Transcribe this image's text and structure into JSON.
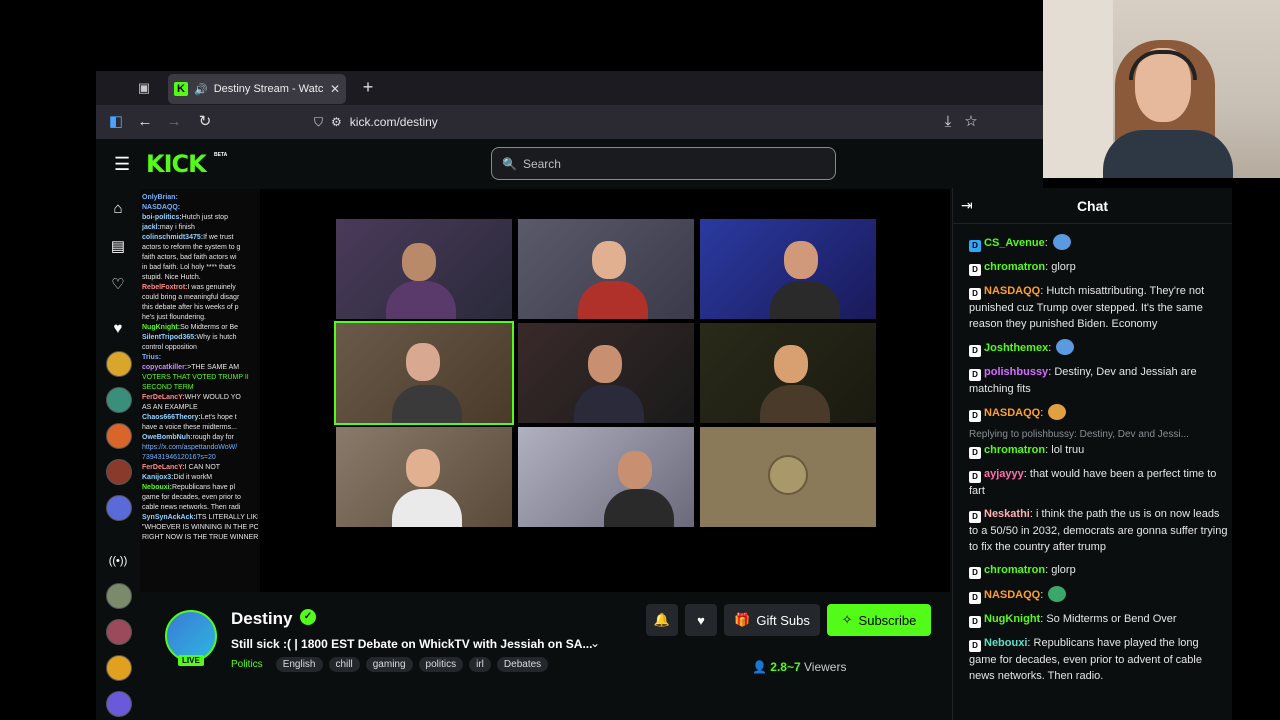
{
  "browser": {
    "tab": {
      "title": "Destiny Stream - Watch Live",
      "favicon": "K"
    },
    "url": "kick.com/destiny"
  },
  "kick": {
    "logo": "KICK",
    "beta": "BETA",
    "search_placeholder": "Search"
  },
  "overlay_chat": [
    {
      "user": "OnlyBrian:",
      "text": "",
      "color": "#6fb3ff"
    },
    {
      "user": "NASDAQQ:",
      "text": "",
      "color": "#6fb3ff"
    },
    {
      "user": "boi-politics:",
      "text": "Hutch just stop",
      "color": "#e6e6e6"
    },
    {
      "user": "jackl:",
      "text": "may i finish",
      "color": "#e6e6e6"
    },
    {
      "user": "colinschmidt3475:",
      "text": "If we trust",
      "color": "#e6e6e6"
    },
    {
      "user": "",
      "text": "actors to reform the system to g",
      "color": "#e6e6e6"
    },
    {
      "user": "",
      "text": "faith actors, bad faith actors wi",
      "color": "#e6e6e6"
    },
    {
      "user": "",
      "text": "in bad faith. Lol holy **** that's",
      "color": "#e6e6e6"
    },
    {
      "user": "",
      "text": "stupid. Nice Hutch.",
      "color": "#e6e6e6"
    },
    {
      "user": "RebelFoxtrot:",
      "text": "I was genuinely",
      "color": "#ff8a8a"
    },
    {
      "user": "",
      "text": "could bring a meaningful disagr",
      "color": "#e6e6e6"
    },
    {
      "user": "",
      "text": "this debate after his weeks of p",
      "color": "#e6e6e6"
    },
    {
      "user": "",
      "text": "he's just floundering.",
      "color": "#e6e6e6"
    },
    {
      "user": "NugKnight:",
      "text": "So Midterms or Be",
      "color": "#53fc18"
    },
    {
      "user": "SilentTripod365:",
      "text": "Why is hutch",
      "color": "#e6e6e6"
    },
    {
      "user": "",
      "text": "control opposition",
      "color": "#e6e6e6"
    },
    {
      "user": "Trius:",
      "text": "",
      "color": "#6fb3ff"
    },
    {
      "user": "copycatkiller:",
      "text": ">THE SAME AM",
      "color": "#c98bff"
    },
    {
      "user": "",
      "text": "VOTERS THAT VOTED TRUMP II",
      "color": "#53fc18"
    },
    {
      "user": "",
      "text": "SECOND TERM",
      "color": "#53fc18"
    },
    {
      "user": "FerDeLancY:",
      "text": "WHY WOULD YO",
      "color": "#ff8a8a"
    },
    {
      "user": "",
      "text": "AS AN EXAMPLE",
      "color": "#e6e6e6"
    },
    {
      "user": "Chaos666Theory:",
      "text": "Let's hope t",
      "color": "#e6e6e6"
    },
    {
      "user": "",
      "text": "have a voice these midterms...",
      "color": "#e6e6e6"
    },
    {
      "user": "OweBombNuh:",
      "text": "rough day for",
      "color": "#e6e6e6"
    },
    {
      "user": "",
      "text": "https://x.com/aspettandoWoW/",
      "color": "#6fb3ff"
    },
    {
      "user": "",
      "text": "73943194612016?s=20",
      "color": "#6fb3ff"
    },
    {
      "user": "FerDeLancY:",
      "text": "I CAN NOT",
      "color": "#ff8a8a"
    },
    {
      "user": "Kanijox3:",
      "text": "Did it workM",
      "color": "#e6e6e6"
    },
    {
      "user": "Nebouxi:",
      "text": "Republicans have pl",
      "color": "#53fc18"
    },
    {
      "user": "",
      "text": "game for decades, even prior to",
      "color": "#e6e6e6"
    },
    {
      "user": "",
      "text": "cable news networks. Then radi",
      "color": "#e6e6e6"
    },
    {
      "user": "SynSynAckAck:",
      "text": "ITS LITERALLY LIKE",
      "color": "#e6e6e6"
    },
    {
      "user": "",
      "text": "\"WHOEVER IS WINNING IN THE POLLS",
      "color": "#e6e6e6"
    },
    {
      "user": "",
      "text": "RIGHT NOW IS THE TRUE WINNER\"",
      "color": "#e6e6e6"
    }
  ],
  "channel": {
    "name": "Destiny",
    "live": "LIVE",
    "title": "Still sick :( | 1800 EST Debate on WhickTV with Jessiah on SA...",
    "category": "Politics",
    "tags": [
      "English",
      "chill",
      "gaming",
      "politics",
      "irl",
      "Debates"
    ],
    "viewers_count": "2.8~7",
    "viewers_label": "Viewers",
    "gift_subs": "Gift Subs",
    "subscribe": "Subscribe"
  },
  "chat": {
    "title": "Chat",
    "messages": [
      {
        "user": "CS_Avenue",
        "text": "",
        "color": "#53fc18",
        "reply": ""
      },
      {
        "user": "chromatron",
        "text": "glorp",
        "color": "#53fc18",
        "reply": ""
      },
      {
        "user": "NASDAQQ",
        "text": "Hutch misattributing. They're not punished cuz Trump over stepped. It's the same reason they punished Biden. Economy",
        "color": "#ff9f2e",
        "reply": ""
      },
      {
        "user": "Joshthemex",
        "text": "",
        "color": "#53fc18",
        "reply": ""
      },
      {
        "user": "polishbussy",
        "text": "Destiny, Dev and Jessiah are matching fits",
        "color": "#d56bff",
        "reply": ""
      },
      {
        "user": "NASDAQQ",
        "text": "",
        "color": "#ff9f2e",
        "reply": ""
      },
      {
        "user": "chromatron",
        "text": "lol truu",
        "color": "#53fc18",
        "reply": "Replying to polishbussy: Destiny, Dev and Jessi..."
      },
      {
        "user": "ayjayyy",
        "text": "that would have been a perfect time to fart",
        "color": "#ff6fb0",
        "reply": ""
      },
      {
        "user": "Neskathi",
        "text": "i think the path the us is on now leads to a 50/50 in 2032, democrats are gonna suffer trying to fix the country after trump",
        "color": "#ffb0b0",
        "reply": ""
      },
      {
        "user": "chromatron",
        "text": "glorp",
        "color": "#53fc18",
        "reply": ""
      },
      {
        "user": "NASDAQQ",
        "text": "",
        "color": "#ff9f2e",
        "reply": ""
      },
      {
        "user": "NugKnight",
        "text": "So Midterms or Bend Over",
        "color": "#53fc18",
        "reply": ""
      },
      {
        "user": "Nebouxi",
        "text": "Republicans have played the long game for decades, even prior to advent of cable news networks. Then radio.",
        "color": "#5ee0c8",
        "reply": ""
      }
    ]
  },
  "colors": {
    "accent": "#53fc18",
    "page_bg": "#0b0e0f"
  }
}
